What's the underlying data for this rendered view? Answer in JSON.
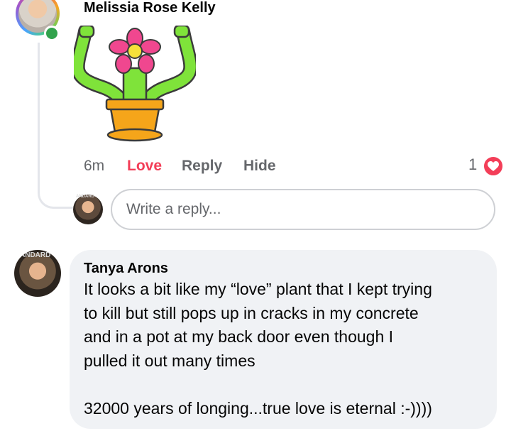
{
  "comment": {
    "author": "Melissia Rose Kelly",
    "sticker": "flower-flexing-sticker",
    "time": "6m",
    "actions": {
      "love": "Love",
      "reply": "Reply",
      "hide": "Hide"
    },
    "reaction_count": "1",
    "reaction_icon": "heart-icon",
    "online": true
  },
  "reply_input": {
    "placeholder": "Write a reply..."
  },
  "reply": {
    "author": "Tanya Arons",
    "avatar_tag": "ANDARD",
    "text": "It looks a bit like my “love” plant that I kept trying\nto kill but still pops up in cracks in my concrete\nand in a pot at my back door even though I\npulled it out many times\n\n32000 years of longing...true love is eternal :-))))"
  },
  "colors": {
    "love": "#f33e58",
    "muted": "#65676b",
    "bubble": "#f0f2f5",
    "online": "#31a24c"
  }
}
